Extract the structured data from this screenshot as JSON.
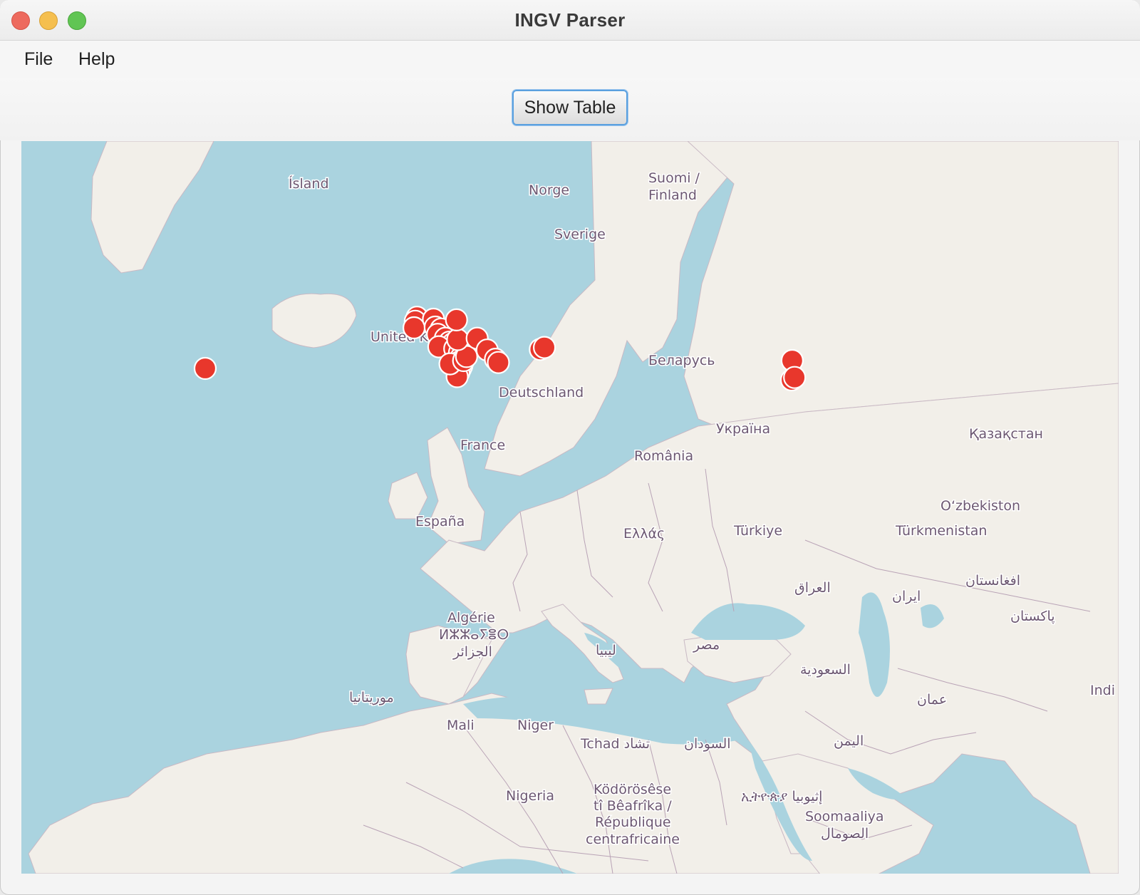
{
  "window": {
    "title": "INGV Parser"
  },
  "menu": {
    "file": "File",
    "help": "Help"
  },
  "toolbar": {
    "show_table": "Show Table"
  },
  "map": {
    "labels": {
      "island": "Ísland",
      "norge": "Norge",
      "suomi1": "Suomi /",
      "suomi2": "Finland",
      "sverige": "Sverige",
      "uk": "United Kingdom",
      "belarus": "Беларусь",
      "deutschland": "Deutschland",
      "ukraina": "Україна",
      "kazakhstan": "Қазақстан",
      "france": "France",
      "romania": "România",
      "uzbekistan": "O‘zbekiston",
      "espana": "España",
      "turkiye": "Türkiye",
      "turkmenistan": "Türkmenistan",
      "greece": "Ελλάς",
      "iraq": "العراق",
      "iran": "ایران",
      "afghanistan": "افغانستان",
      "algerie1": "Algérie",
      "algerie2": "ⵍⵣⵣⴰⵢⴻⵔ",
      "algerie3": "الجزائر",
      "libya": "ليبيا",
      "egypt": "مصر",
      "pakistan": "پاکستان",
      "saudi": "السعودية",
      "india": "Indi",
      "mauritania": "موريتانيا",
      "oman": "عمان",
      "mali": "Mali",
      "niger": "Niger",
      "tchad": "Tchad تشاد",
      "sudan": "السودان",
      "yemen": "اليمن",
      "nigeria": "Nigeria",
      "car1": "Ködörösêse",
      "car2": "tî Bêafrîka /",
      "car3": "République",
      "car4": "centrafricaine",
      "ethiopia": "ኢትዮጵያ إثيوبيا",
      "somalia1": "Soomaaliya",
      "somalia2": "الصومال"
    },
    "markers": [
      {
        "lat": 38.0,
        "lon": -28.5
      },
      {
        "lat": 45.8,
        "lon": 7.4
      },
      {
        "lat": 45.2,
        "lon": 7.1
      },
      {
        "lat": 44.2,
        "lon": 6.9
      },
      {
        "lat": 45.5,
        "lon": 10.2
      },
      {
        "lat": 44.3,
        "lon": 10.5
      },
      {
        "lat": 44.0,
        "lon": 11.5
      },
      {
        "lat": 43.2,
        "lon": 10.9
      },
      {
        "lat": 42.6,
        "lon": 12.2
      },
      {
        "lat": 42.0,
        "lon": 12.9
      },
      {
        "lat": 41.8,
        "lon": 13.5
      },
      {
        "lat": 41.3,
        "lon": 11.1
      },
      {
        "lat": 41.0,
        "lon": 13.8
      },
      {
        "lat": 40.4,
        "lon": 14.6
      },
      {
        "lat": 39.7,
        "lon": 14.9
      },
      {
        "lat": 39.0,
        "lon": 14.6
      },
      {
        "lat": 38.4,
        "lon": 15.0
      },
      {
        "lat": 38.0,
        "lon": 14.8
      },
      {
        "lat": 37.5,
        "lon": 14.5
      },
      {
        "lat": 37.0,
        "lon": 14.2
      },
      {
        "lat": 38.7,
        "lon": 13.0
      },
      {
        "lat": 39.2,
        "lon": 15.3
      },
      {
        "lat": 39.8,
        "lon": 15.8
      },
      {
        "lat": 42.4,
        "lon": 14.3
      },
      {
        "lat": 45.4,
        "lon": 14.1
      },
      {
        "lat": 42.6,
        "lon": 17.6
      },
      {
        "lat": 40.8,
        "lon": 19.3
      },
      {
        "lat": 39.4,
        "lon": 20.7
      },
      {
        "lat": 38.9,
        "lon": 21.2
      },
      {
        "lat": 40.9,
        "lon": 28.3
      },
      {
        "lat": 41.2,
        "lon": 29.0
      },
      {
        "lat": 39.2,
        "lon": 71.0
      },
      {
        "lat": 36.6,
        "lon": 70.9
      },
      {
        "lat": 36.9,
        "lon": 71.4
      }
    ]
  }
}
